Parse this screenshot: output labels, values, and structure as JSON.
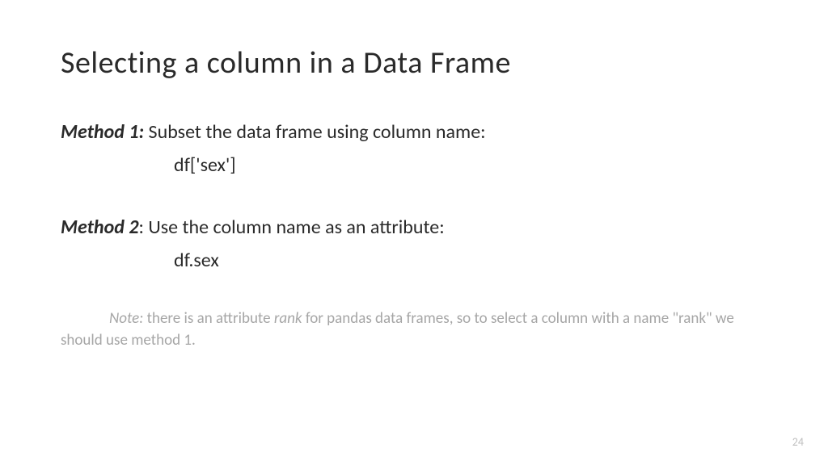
{
  "title": "Selecting a column in a Data Frame",
  "method1": {
    "label": "Method 1:",
    "description": "   Subset the data frame using column name:",
    "code": "df['sex']"
  },
  "method2": {
    "label": "Method 2",
    "colon": ":",
    "description": "   Use the column name as an attribute:",
    "code": "df.sex"
  },
  "note": {
    "label": "Note: ",
    "text1": "there is an attribute ",
    "rank": "rank",
    "text2": " for pandas data frames, so to select a column with a name \"rank\" we should use method 1."
  },
  "pageNumber": "24"
}
